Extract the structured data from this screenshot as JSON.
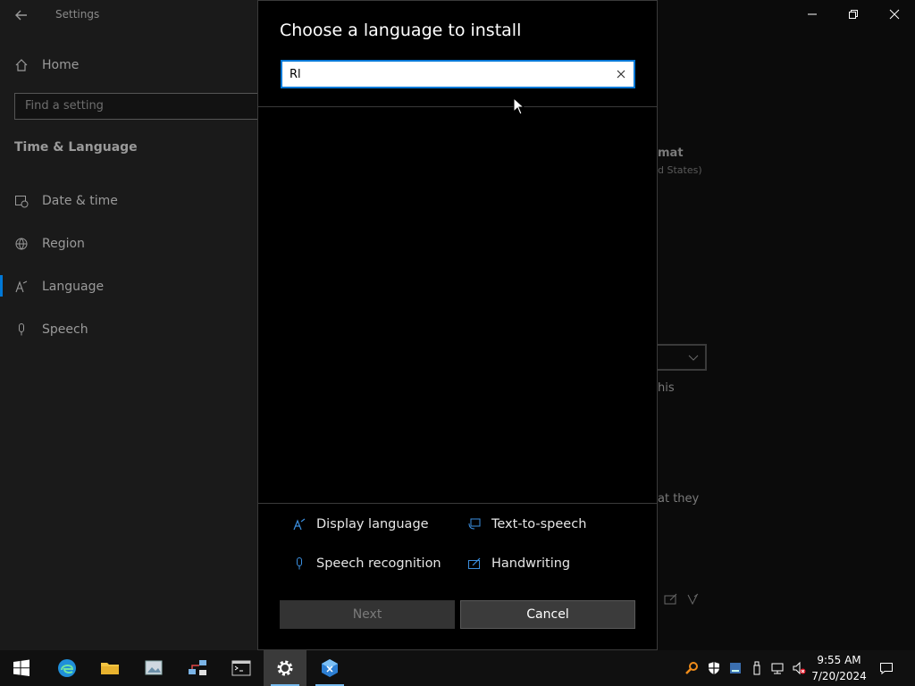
{
  "settings": {
    "window_title": "Settings",
    "home_label": "Home",
    "search_placeholder": "Find a setting",
    "section_title": "Time & Language",
    "nav_items": [
      {
        "label": "Date & time",
        "icon": "calendar-clock-icon"
      },
      {
        "label": "Region",
        "icon": "globe-icon"
      },
      {
        "label": "Language",
        "icon": "language-icon"
      },
      {
        "label": "Speech",
        "icon": "microphone-icon"
      }
    ],
    "background_fragments": {
      "format_heading": "mat",
      "format_sub": "d States)",
      "text_this": "his",
      "text_they": "at they"
    }
  },
  "dialog": {
    "title": "Choose a language to install",
    "search_value": "Rl",
    "features": [
      {
        "label": "Display language",
        "icon": "display-language-icon"
      },
      {
        "label": "Text-to-speech",
        "icon": "text-to-speech-icon"
      },
      {
        "label": "Speech recognition",
        "icon": "microphone-icon"
      },
      {
        "label": "Handwriting",
        "icon": "handwriting-icon"
      }
    ],
    "next_label": "Next",
    "cancel_label": "Cancel"
  },
  "taskbar": {
    "time": "9:55 AM",
    "date": "7/20/2024"
  },
  "colors": {
    "accent": "#0078d7",
    "dialog_bg": "#000000",
    "taskbar_bg": "#101010"
  }
}
